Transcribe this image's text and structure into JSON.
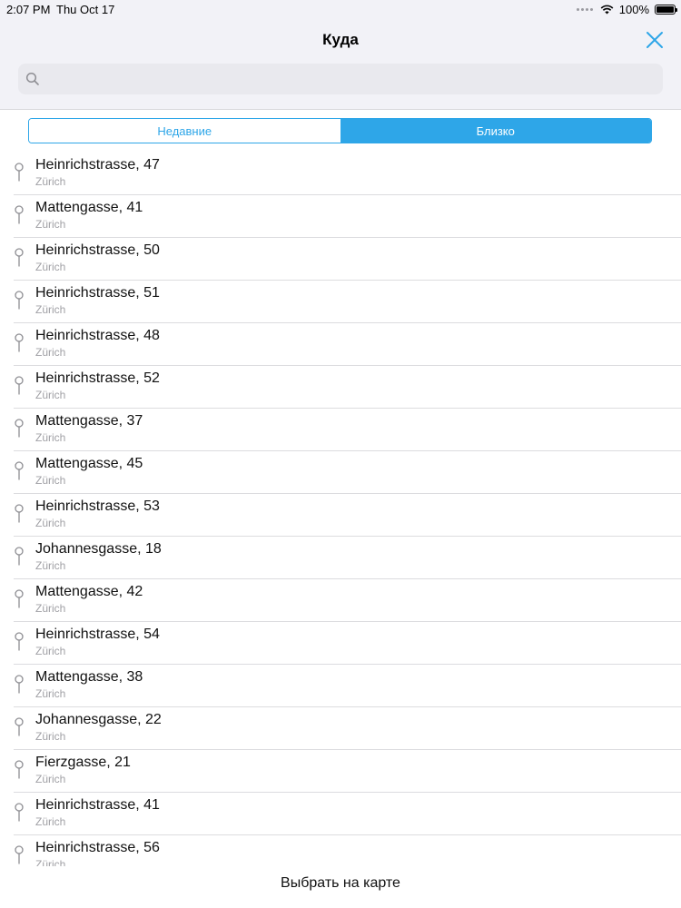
{
  "status_bar": {
    "time": "2:07 PM",
    "date": "Thu Oct 17",
    "battery": "100%"
  },
  "header": {
    "title": "Куда",
    "close_icon": "close-icon"
  },
  "search": {
    "value": "",
    "placeholder": ""
  },
  "tabs": {
    "recent_label": "Недавние",
    "nearby_label": "Близко",
    "selected": "nearby"
  },
  "places": [
    {
      "title": "Heinrichstrasse, 47",
      "city": "Zürich"
    },
    {
      "title": "Mattengasse, 41",
      "city": "Zürich"
    },
    {
      "title": "Heinrichstrasse, 50",
      "city": "Zürich"
    },
    {
      "title": "Heinrichstrasse, 51",
      "city": "Zürich"
    },
    {
      "title": "Heinrichstrasse, 48",
      "city": "Zürich"
    },
    {
      "title": "Heinrichstrasse, 52",
      "city": "Zürich"
    },
    {
      "title": "Mattengasse, 37",
      "city": "Zürich"
    },
    {
      "title": "Mattengasse, 45",
      "city": "Zürich"
    },
    {
      "title": "Heinrichstrasse, 53",
      "city": "Zürich"
    },
    {
      "title": "Johannesgasse, 18",
      "city": "Zürich"
    },
    {
      "title": "Mattengasse, 42",
      "city": "Zürich"
    },
    {
      "title": "Heinrichstrasse, 54",
      "city": "Zürich"
    },
    {
      "title": "Mattengasse, 38",
      "city": "Zürich"
    },
    {
      "title": "Johannesgasse, 22",
      "city": "Zürich"
    },
    {
      "title": "Fierzgasse, 21",
      "city": "Zürich"
    },
    {
      "title": "Heinrichstrasse, 41",
      "city": "Zürich"
    },
    {
      "title": "Heinrichstrasse, 56",
      "city": "Zürich"
    }
  ],
  "bottom": {
    "map_label": "Выбрать на карте"
  },
  "colors": {
    "accent": "#2ea6e8",
    "secondary_text": "#a0a0a5",
    "header_bg": "#f2f2f7"
  }
}
